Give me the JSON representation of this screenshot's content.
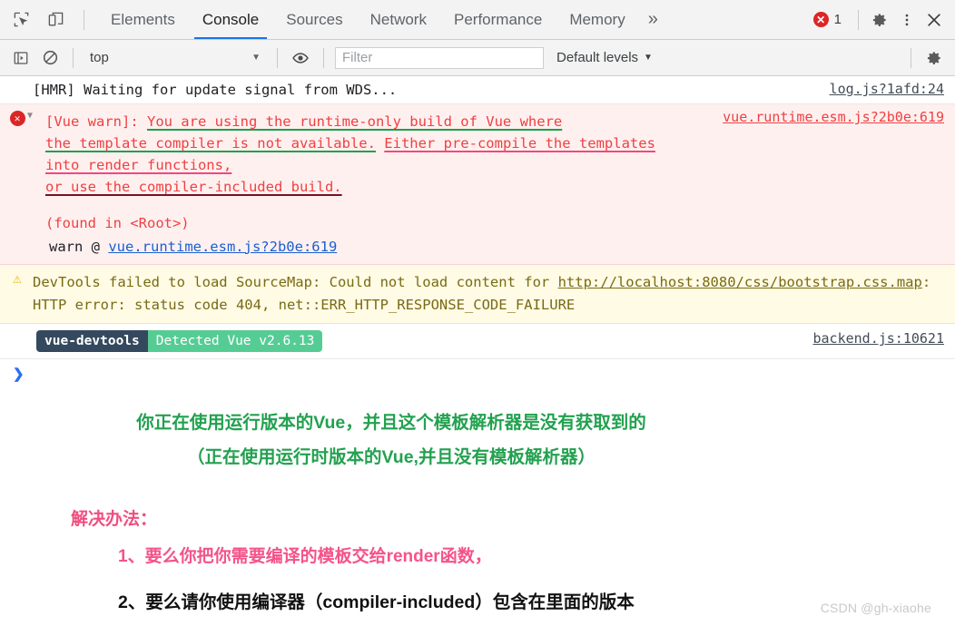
{
  "toolbar": {
    "inspect_icon": "inspect-cursor-icon",
    "device_icon": "device-toolbar-icon",
    "more_tabs_label": "»",
    "error_count": "1",
    "settings_icon": "gear-icon",
    "kebab_icon": "more-options-icon",
    "close_icon": "close-icon",
    "tabs": [
      {
        "label": "Elements",
        "active": false
      },
      {
        "label": "Console",
        "active": true
      },
      {
        "label": "Sources",
        "active": false
      },
      {
        "label": "Network",
        "active": false
      },
      {
        "label": "Performance",
        "active": false
      },
      {
        "label": "Memory",
        "active": false
      }
    ]
  },
  "filterbar": {
    "sidebar_icon": "console-sidebar-icon",
    "clear_icon": "clear-console-icon",
    "context": "top",
    "context_caret": "▼",
    "eye_icon": "live-expression-eye-icon",
    "filter_placeholder": "Filter",
    "filter_value": "",
    "levels_label": "Default levels",
    "levels_caret": "▼",
    "settings_icon": "console-settings-gear-icon"
  },
  "console": {
    "hmr": {
      "text": "[HMR] Waiting for update signal from WDS...",
      "source": "log.js?1afd:24"
    },
    "vue_warn": {
      "error_icon": "error-circle-icon",
      "disclosure": "▼",
      "prefix": "[Vue warn]: ",
      "seg_green_1": "You are using the runtime-only build of Vue where",
      "seg_green_2": "the template compiler is not available.",
      "seg_pink": "Either pre-compile the templates into render functions,",
      "seg_dark": "or use the compiler-included build.",
      "found_in": "(found in <Root>)",
      "stack_prefix": "warn @ ",
      "stack_link": "vue.runtime.esm.js?2b0e:619",
      "source": "vue.runtime.esm.js?2b0e:619"
    },
    "sourcemap_warn": {
      "warn_icon": "warning-triangle-icon",
      "text_before": "DevTools failed to load SourceMap: Could not load content for ",
      "url": "http://localhost:8080/css/bootstrap.css.map",
      "text_after": ": HTTP error: status code 404, net::ERR_HTTP_RESPONSE_CODE_FAILURE"
    },
    "devtools_badge": {
      "left": "vue-devtools",
      "right": "Detected Vue v2.6.13",
      "source": "backend.js:10621"
    },
    "prompt_caret": "❯"
  },
  "annotations": {
    "green_line_1": "你正在使用运行版本的Vue，并且这个模板解析器是没有获取到的",
    "green_line_2": "（正在使用运行时版本的Vue,并且没有模板解析器）",
    "solution_title": "解决办法：",
    "solution_1": "1、要么你把你需要编译的模板交给render函数，",
    "solution_2": "2、要么请你使用编译器（compiler-included）包含在里面的版本"
  },
  "watermark": "CSDN @gh-xiaohe",
  "colors": {
    "accent": "#1a73e8",
    "error": "#dc2626",
    "warn": "#e9b308",
    "vue_green": "#56cc95",
    "vue_navy": "#35495e",
    "annot_green": "#22a14f",
    "annot_pink": "#f4538a"
  }
}
